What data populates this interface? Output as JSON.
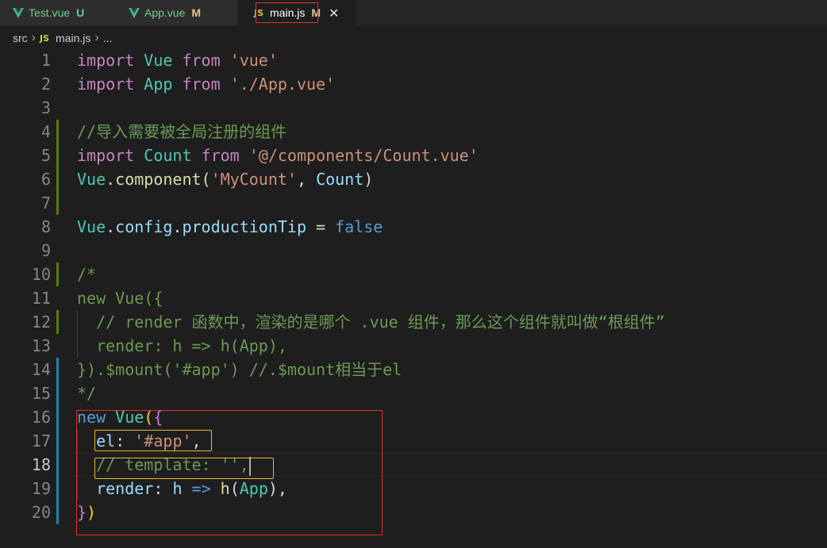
{
  "tabs": [
    {
      "name": "Test.vue",
      "status": "U",
      "icon": "vue-icon"
    },
    {
      "name": "App.vue",
      "status": "M",
      "icon": "vue-icon"
    },
    {
      "name": "main.js",
      "status": "M",
      "icon": "js-icon",
      "icon_text": "JS",
      "close": "✕"
    }
  ],
  "breadcrumb": {
    "folder": "src",
    "icon_text": "JS",
    "file": "main.js",
    "more": "..."
  },
  "line_numbers": [
    "1",
    "2",
    "3",
    "4",
    "5",
    "6",
    "7",
    "8",
    "9",
    "10",
    "11",
    "12",
    "13",
    "14",
    "15",
    "16",
    "17",
    "18",
    "19",
    "20"
  ],
  "code": {
    "l1": {
      "t1": "import",
      "t2": " ",
      "t3": "Vue",
      "t4": " ",
      "t5": "from",
      "t6": " ",
      "t7": "'vue'"
    },
    "l2": {
      "t1": "import",
      "t2": " ",
      "t3": "App",
      "t4": " ",
      "t5": "from",
      "t6": " ",
      "t7": "'./App.vue'"
    },
    "l4": {
      "t1": "//导入需要被全局注册的组件"
    },
    "l5": {
      "t1": "import",
      "t2": " ",
      "t3": "Count",
      "t4": " ",
      "t5": "from",
      "t6": " ",
      "t7": "'@/components/Count.vue'"
    },
    "l6": {
      "t1": "Vue",
      "t2": ".",
      "t3": "component",
      "t4": "(",
      "t5": "'MyCount'",
      "t6": ", ",
      "t7": "Count",
      "t8": ")"
    },
    "l8": {
      "t1": "Vue",
      "t2": ".",
      "t3": "config",
      "t4": ".",
      "t5": "productionTip",
      "t6": " = ",
      "t7": "false"
    },
    "l10": {
      "t1": "/*"
    },
    "l11": {
      "t1": "new Vue({"
    },
    "l12": {
      "t1": "  // render 函数中，渲染的是哪个 .vue 组件，那么这个组件就叫做“根组件”"
    },
    "l13": {
      "t1": "  render: h => h(App),"
    },
    "l14": {
      "t1": "}).$mount('#app') //.$mount相当于el"
    },
    "l15": {
      "t1": "*/"
    },
    "l16": {
      "t1": "new",
      "t2": " ",
      "t3": "Vue",
      "t4": "(",
      "t5": "{"
    },
    "l17": {
      "t1": "  ",
      "t2": "el",
      "t3": ": ",
      "t4": "'#app'",
      "t5": ","
    },
    "l18": {
      "t1": "  // template: '',"
    },
    "l19": {
      "t1": "  ",
      "t2": "render",
      "t3": ": ",
      "t4": "h",
      "t5": " => ",
      "t6": "h",
      "t7": "(",
      "t8": "App",
      "t9": "),"
    },
    "l20": {
      "t1": "}",
      "t2": ")"
    }
  },
  "colors": {
    "editor_bg": "#1e1e1e",
    "highlight_red": "#e0302b",
    "highlight_yellow": "#e8ba36"
  }
}
